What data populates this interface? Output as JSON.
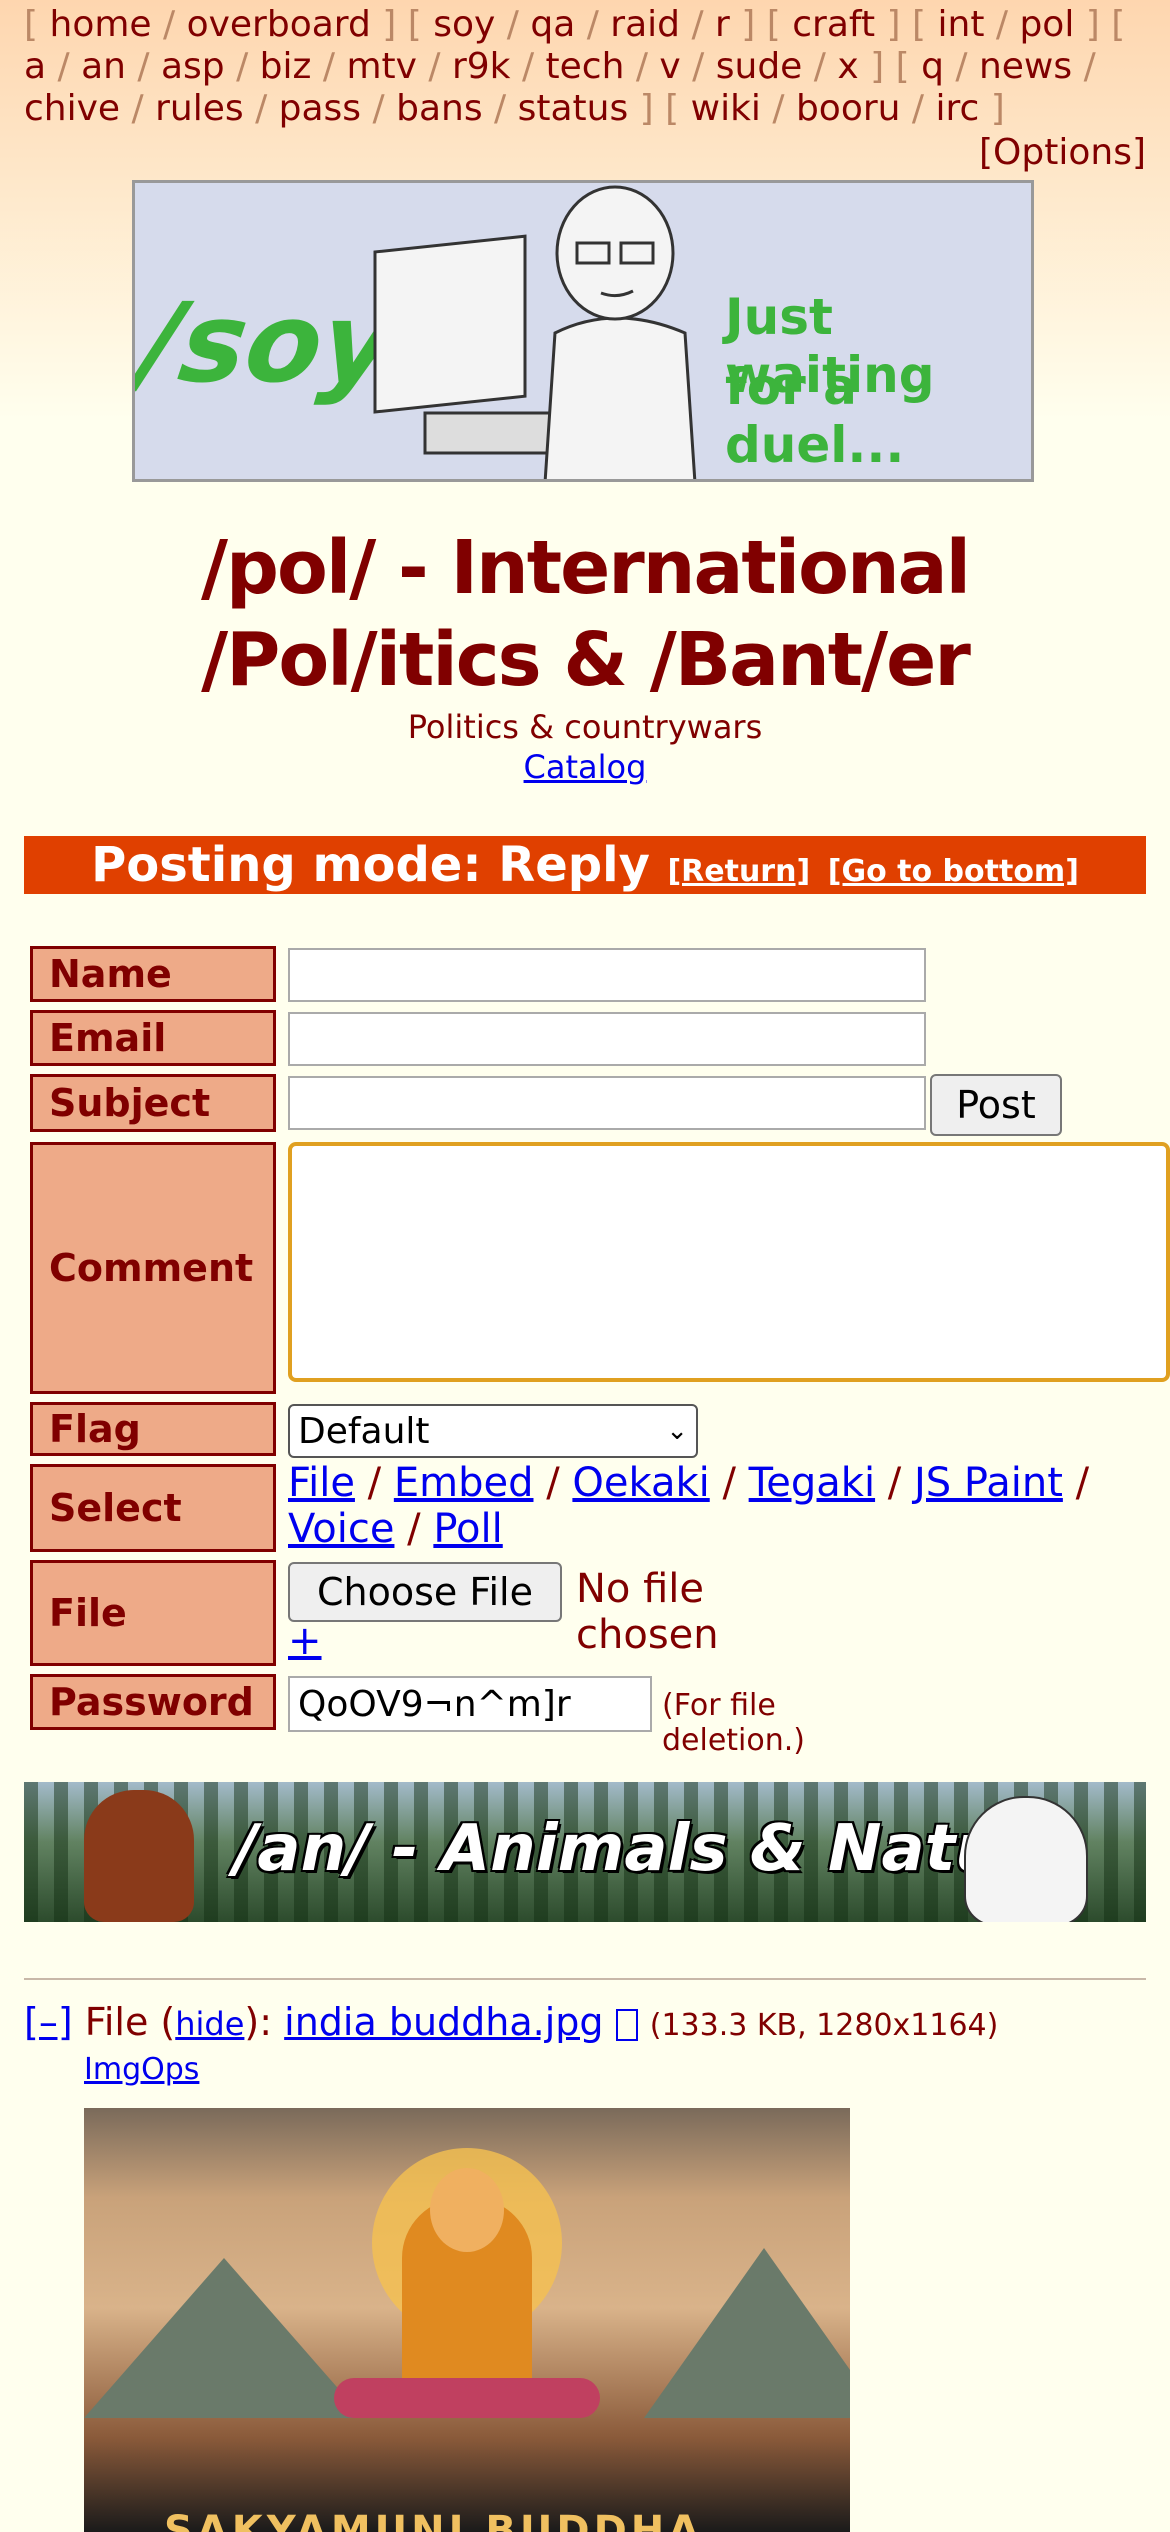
{
  "boardlist": {
    "groups": [
      [
        "home",
        "overboard"
      ],
      [
        "soy",
        "qa",
        "raid",
        "r"
      ],
      [
        "craft"
      ],
      [
        "int",
        "pol"
      ],
      [
        "a",
        "an",
        "asp",
        "biz",
        "mtv",
        "r9k",
        "tech",
        "v",
        "sude",
        "x"
      ],
      [
        "q",
        "news",
        "chive",
        "rules",
        "pass",
        "bans",
        "status"
      ],
      [
        "wiki",
        "booru",
        "irc"
      ]
    ],
    "options": "[Options]"
  },
  "banner": {
    "board_text": "/soy/",
    "caption_line1": "Just waiting",
    "caption_line2": "for a duel..."
  },
  "board": {
    "title": "/pol/ - International /Pol/itics & /Bant/er",
    "subtitle": "Politics & countrywars",
    "catalog": "Catalog"
  },
  "posting_mode": {
    "label": "Posting mode: Reply",
    "return": "[Return]",
    "go_bottom": "[Go to bottom]"
  },
  "form": {
    "name_label": "Name",
    "email_label": "Email",
    "subject_label": "Subject",
    "post_button": "Post",
    "comment_label": "Comment",
    "flag_label": "Flag",
    "flag_value": "Default",
    "select_label": "Select",
    "select_options": [
      "File",
      "Embed",
      "Oekaki",
      "Tegaki",
      "JS Paint",
      "Voice",
      "Poll"
    ],
    "file_label": "File",
    "choose_file": "Choose File",
    "no_file": "No file chosen",
    "plus": "+",
    "password_label": "Password",
    "password_value": "QoOV9¬n^m]r",
    "password_note": "(For file deletion.)"
  },
  "an_banner": {
    "text": "/an/ - Animals & Nature"
  },
  "post": {
    "collapse": "[–]",
    "file_prefix": "File (",
    "hide": "hide",
    "file_mid": "):",
    "filename": "india buddha.jpg",
    "file_icon": "external-link-icon",
    "file_meta": "(133.3 KB, 1280x1164)",
    "imgops": "ImgOps",
    "image_caption": "SAKYAMUNI BUDDHA GAME"
  }
}
